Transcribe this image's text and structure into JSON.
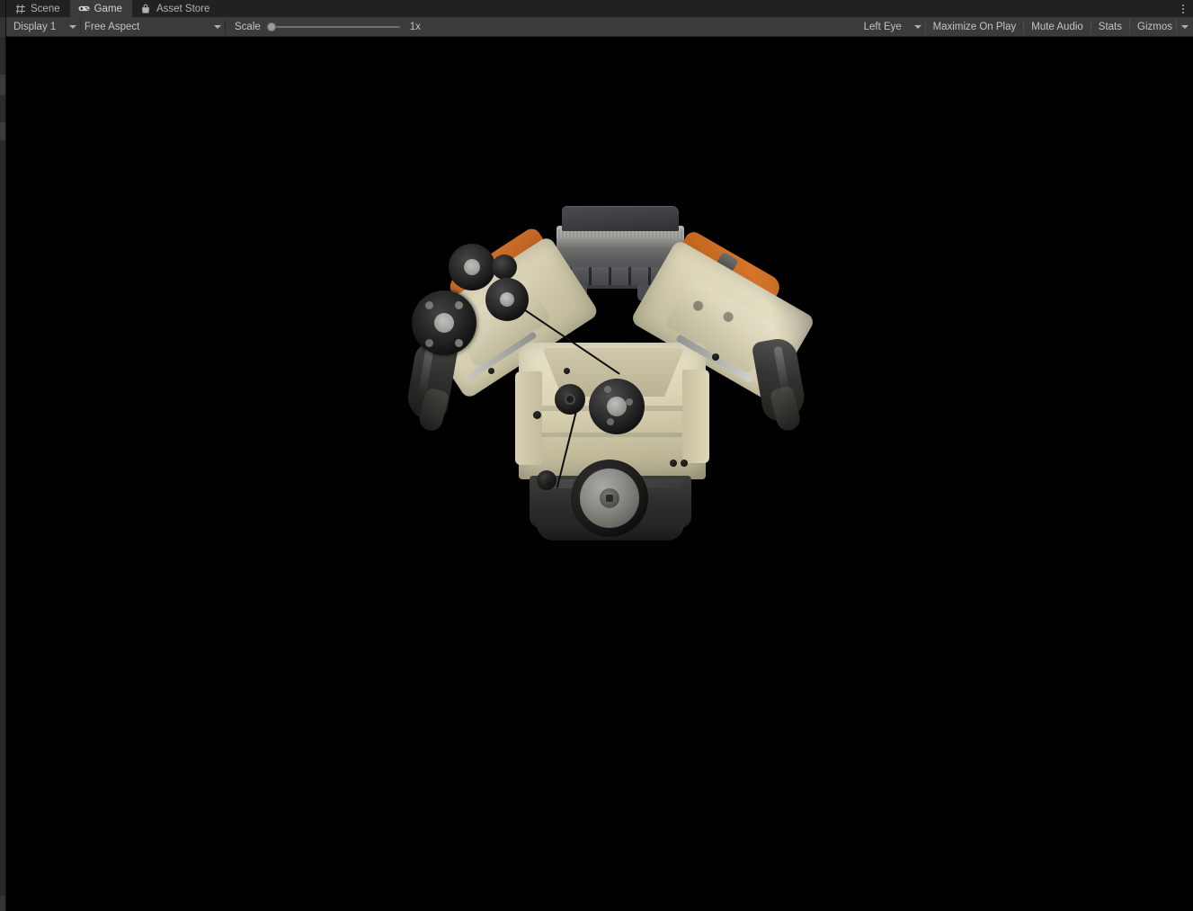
{
  "window": {
    "tabs": [
      {
        "label": "Scene",
        "icon": "grid-icon",
        "active": false
      },
      {
        "label": "Game",
        "icon": "gamepad-icon",
        "active": true
      },
      {
        "label": "Asset Store",
        "icon": "shopping-bag-icon",
        "active": false
      }
    ],
    "overflow_menu_icon": "kebab-menu-icon"
  },
  "toolbar": {
    "display": {
      "value": "Display 1",
      "caret_icon": "chevron-down-icon"
    },
    "aspect": {
      "value": "Free Aspect",
      "caret_icon": "chevron-down-icon"
    },
    "scale": {
      "label": "Scale",
      "value": "1x",
      "slider_position_pct": 0
    },
    "left_eye": {
      "value": "Left Eye",
      "caret_icon": "chevron-down-icon"
    },
    "maximize_on_play": "Maximize On Play",
    "mute_audio": "Mute Audio",
    "stats": "Stats",
    "gizmos": {
      "label": "Gizmos",
      "caret_icon": "chevron-down-icon"
    }
  },
  "game_view": {
    "background_color": "#000000",
    "content_description": "V-configuration automotive engine 3D model",
    "model_parts": {
      "intake_manifold": "dark gray plenum",
      "valve_covers": "orange",
      "engine_block": "cream / beige cast",
      "pulleys": "black accessory drive pulleys",
      "crank_pulley": "large harmonic balancer",
      "exhaust_manifolds": "dark metal headers",
      "oil_pan": "dark charcoal sump"
    }
  },
  "colors": {
    "tabbar_bg": "#212121",
    "toolbar_bg": "#3b3b3b",
    "active_tab_bg": "#3b3b3b",
    "text": "#c4c4c4",
    "viewport_bg": "#000000",
    "engine_cream": "#dcd5b6",
    "engine_orange": "#d4762c",
    "engine_dark": "#2e2f33"
  }
}
